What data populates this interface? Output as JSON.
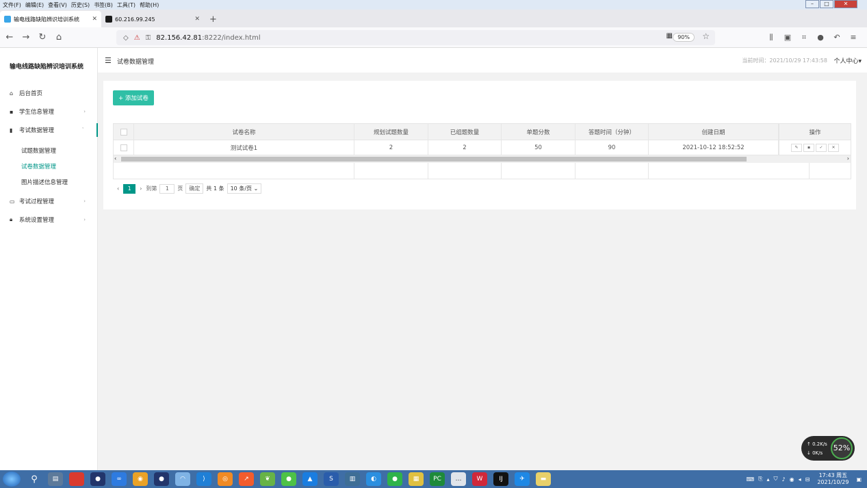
{
  "browser": {
    "menu": [
      "文件(F)",
      "编辑(E)",
      "查看(V)",
      "历史(S)",
      "书签(B)",
      "工具(T)",
      "帮助(H)"
    ],
    "tabs": [
      {
        "label": "输电线路缺陷辨识培训系统",
        "active": true
      },
      {
        "label": "60.216.99.245",
        "active": false
      }
    ],
    "url_host": "82.156.42.81",
    "url_rest": ":8222/index.html",
    "zoom": "90%"
  },
  "app": {
    "title": "输电线路缺陷辨识培训系统",
    "page_title": "试卷数据管理",
    "clock": "当前时间：2021/10/29 17:43:58",
    "user_center": "个人中心",
    "sidebar": [
      {
        "label": "后台首页",
        "icon": "home-icon"
      },
      {
        "label": "学生信息管理",
        "icon": "id-card-icon",
        "arrow": "›"
      },
      {
        "label": "考试数据管理",
        "icon": "file-icon",
        "arrow": "ˇ"
      },
      {
        "label": "考试过程管理",
        "icon": "monitor-icon",
        "arrow": "›"
      },
      {
        "label": "系统设置管理",
        "icon": "lock-icon",
        "arrow": "›"
      }
    ],
    "sub_items": [
      "试题数据管理",
      "试卷数据管理",
      "图片描述信息管理"
    ],
    "add_button": "+ 添加试卷",
    "table": {
      "headers": [
        "试卷名称",
        "规划试题数量",
        "已组题数量",
        "单题分数",
        "答题时间（分钟）",
        "创建日期",
        "操作"
      ],
      "rows": [
        {
          "name": "测试试卷1",
          "planned": "2",
          "assembled": "2",
          "score": "50",
          "time": "90",
          "created": "2021-10-12 18:52:52"
        }
      ]
    },
    "pager": {
      "page": "1",
      "goto": "到第",
      "page_input": "1",
      "page_unit": "页",
      "confirm": "确定",
      "total": "共 1 条",
      "per_page": "10 条/页"
    }
  },
  "net_widget": {
    "up": "0.2K/s",
    "down": "0K/s",
    "gauge": "52%"
  },
  "taskbar": {
    "time": "17:43 周五",
    "date": "2021/10/29"
  }
}
